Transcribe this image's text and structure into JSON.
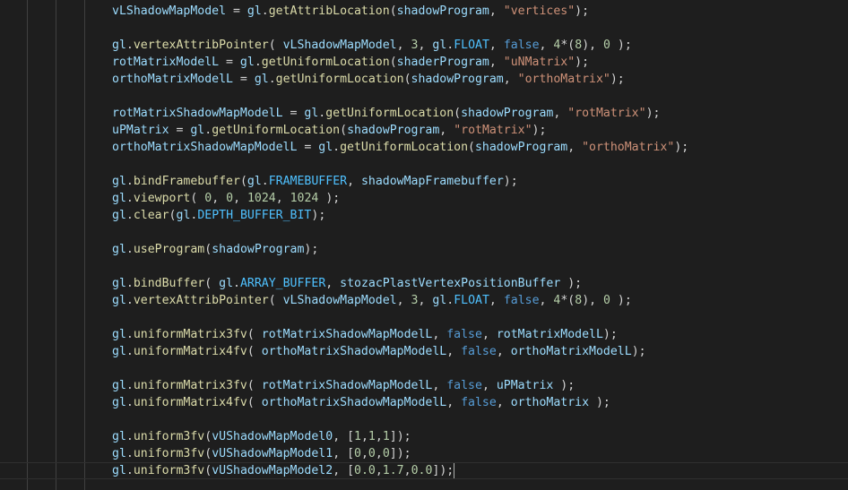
{
  "editor": {
    "lines": [
      [
        [
          "var",
          "vLShadowMapModel"
        ],
        [
          "p",
          " = "
        ],
        [
          "var",
          "gl"
        ],
        [
          "p",
          "."
        ],
        [
          "fn",
          "getAttribLocation"
        ],
        [
          "p",
          "("
        ],
        [
          "var",
          "shadowProgram"
        ],
        [
          "p",
          ", "
        ],
        [
          "str",
          "\"vertices\""
        ],
        [
          "p",
          ");"
        ]
      ],
      [],
      [
        [
          "var",
          "gl"
        ],
        [
          "p",
          "."
        ],
        [
          "fn",
          "vertexAttribPointer"
        ],
        [
          "p",
          "( "
        ],
        [
          "var",
          "vLShadowMapModel"
        ],
        [
          "p",
          ", "
        ],
        [
          "num",
          "3"
        ],
        [
          "p",
          ", "
        ],
        [
          "var",
          "gl"
        ],
        [
          "p",
          "."
        ],
        [
          "const",
          "FLOAT"
        ],
        [
          "p",
          ", "
        ],
        [
          "kw",
          "false"
        ],
        [
          "p",
          ", "
        ],
        [
          "num",
          "4"
        ],
        [
          "p",
          "*("
        ],
        [
          "num",
          "8"
        ],
        [
          "p",
          "), "
        ],
        [
          "num",
          "0"
        ],
        [
          "p",
          " );"
        ]
      ],
      [
        [
          "var",
          "rotMatrixModelL"
        ],
        [
          "p",
          " = "
        ],
        [
          "var",
          "gl"
        ],
        [
          "p",
          "."
        ],
        [
          "fn",
          "getUniformLocation"
        ],
        [
          "p",
          "("
        ],
        [
          "var",
          "shaderProgram"
        ],
        [
          "p",
          ", "
        ],
        [
          "str",
          "\"uNMatrix\""
        ],
        [
          "p",
          ");"
        ]
      ],
      [
        [
          "var",
          "orthoMatrixModelL"
        ],
        [
          "p",
          " = "
        ],
        [
          "var",
          "gl"
        ],
        [
          "p",
          "."
        ],
        [
          "fn",
          "getUniformLocation"
        ],
        [
          "p",
          "("
        ],
        [
          "var",
          "shadowProgram"
        ],
        [
          "p",
          ", "
        ],
        [
          "str",
          "\"orthoMatrix\""
        ],
        [
          "p",
          ");"
        ]
      ],
      [],
      [
        [
          "var",
          "rotMatrixShadowMapModelL"
        ],
        [
          "p",
          " = "
        ],
        [
          "var",
          "gl"
        ],
        [
          "p",
          "."
        ],
        [
          "fn",
          "getUniformLocation"
        ],
        [
          "p",
          "("
        ],
        [
          "var",
          "shadowProgram"
        ],
        [
          "p",
          ", "
        ],
        [
          "str",
          "\"rotMatrix\""
        ],
        [
          "p",
          ");"
        ]
      ],
      [
        [
          "var",
          "uPMatrix"
        ],
        [
          "p",
          " = "
        ],
        [
          "var",
          "gl"
        ],
        [
          "p",
          "."
        ],
        [
          "fn",
          "getUniformLocation"
        ],
        [
          "p",
          "("
        ],
        [
          "var",
          "shadowProgram"
        ],
        [
          "p",
          ", "
        ],
        [
          "str",
          "\"rotMatrix\""
        ],
        [
          "p",
          ");"
        ]
      ],
      [
        [
          "var",
          "orthoMatrixShadowMapModelL"
        ],
        [
          "p",
          " = "
        ],
        [
          "var",
          "gl"
        ],
        [
          "p",
          "."
        ],
        [
          "fn",
          "getUniformLocation"
        ],
        [
          "p",
          "("
        ],
        [
          "var",
          "shadowProgram"
        ],
        [
          "p",
          ", "
        ],
        [
          "str",
          "\"orthoMatrix\""
        ],
        [
          "p",
          ");"
        ]
      ],
      [],
      [
        [
          "var",
          "gl"
        ],
        [
          "p",
          "."
        ],
        [
          "fn",
          "bindFramebuffer"
        ],
        [
          "p",
          "("
        ],
        [
          "var",
          "gl"
        ],
        [
          "p",
          "."
        ],
        [
          "const",
          "FRAMEBUFFER"
        ],
        [
          "p",
          ", "
        ],
        [
          "var",
          "shadowMapFramebuffer"
        ],
        [
          "p",
          ");"
        ]
      ],
      [
        [
          "var",
          "gl"
        ],
        [
          "p",
          "."
        ],
        [
          "fn",
          "viewport"
        ],
        [
          "p",
          "( "
        ],
        [
          "num",
          "0"
        ],
        [
          "p",
          ", "
        ],
        [
          "num",
          "0"
        ],
        [
          "p",
          ", "
        ],
        [
          "num",
          "1024"
        ],
        [
          "p",
          ", "
        ],
        [
          "num",
          "1024"
        ],
        [
          "p",
          " );"
        ]
      ],
      [
        [
          "var",
          "gl"
        ],
        [
          "p",
          "."
        ],
        [
          "fn",
          "clear"
        ],
        [
          "p",
          "("
        ],
        [
          "var",
          "gl"
        ],
        [
          "p",
          "."
        ],
        [
          "const",
          "DEPTH_BUFFER_BIT"
        ],
        [
          "p",
          ");"
        ]
      ],
      [],
      [
        [
          "var",
          "gl"
        ],
        [
          "p",
          "."
        ],
        [
          "fn",
          "useProgram"
        ],
        [
          "p",
          "("
        ],
        [
          "var",
          "shadowProgram"
        ],
        [
          "p",
          ");"
        ]
      ],
      [],
      [
        [
          "var",
          "gl"
        ],
        [
          "p",
          "."
        ],
        [
          "fn",
          "bindBuffer"
        ],
        [
          "p",
          "( "
        ],
        [
          "var",
          "gl"
        ],
        [
          "p",
          "."
        ],
        [
          "const",
          "ARRAY_BUFFER"
        ],
        [
          "p",
          ", "
        ],
        [
          "var",
          "stozacPlastVertexPositionBuffer"
        ],
        [
          "p",
          " );"
        ]
      ],
      [
        [
          "var",
          "gl"
        ],
        [
          "p",
          "."
        ],
        [
          "fn",
          "vertexAttribPointer"
        ],
        [
          "p",
          "( "
        ],
        [
          "var",
          "vLShadowMapModel"
        ],
        [
          "p",
          ", "
        ],
        [
          "num",
          "3"
        ],
        [
          "p",
          ", "
        ],
        [
          "var",
          "gl"
        ],
        [
          "p",
          "."
        ],
        [
          "const",
          "FLOAT"
        ],
        [
          "p",
          ", "
        ],
        [
          "kw",
          "false"
        ],
        [
          "p",
          ", "
        ],
        [
          "num",
          "4"
        ],
        [
          "p",
          "*("
        ],
        [
          "num",
          "8"
        ],
        [
          "p",
          "), "
        ],
        [
          "num",
          "0"
        ],
        [
          "p",
          " );"
        ]
      ],
      [],
      [
        [
          "var",
          "gl"
        ],
        [
          "p",
          "."
        ],
        [
          "fn",
          "uniformMatrix3fv"
        ],
        [
          "p",
          "( "
        ],
        [
          "var",
          "rotMatrixShadowMapModelL"
        ],
        [
          "p",
          ", "
        ],
        [
          "kw",
          "false"
        ],
        [
          "p",
          ", "
        ],
        [
          "var",
          "rotMatrixModelL"
        ],
        [
          "p",
          ");"
        ]
      ],
      [
        [
          "var",
          "gl"
        ],
        [
          "p",
          "."
        ],
        [
          "fn",
          "uniformMatrix4fv"
        ],
        [
          "p",
          "( "
        ],
        [
          "var",
          "orthoMatrixShadowMapModelL"
        ],
        [
          "p",
          ", "
        ],
        [
          "kw",
          "false"
        ],
        [
          "p",
          ", "
        ],
        [
          "var",
          "orthoMatrixModelL"
        ],
        [
          "p",
          ");"
        ]
      ],
      [],
      [
        [
          "var",
          "gl"
        ],
        [
          "p",
          "."
        ],
        [
          "fn",
          "uniformMatrix3fv"
        ],
        [
          "p",
          "( "
        ],
        [
          "var",
          "rotMatrixShadowMapModelL"
        ],
        [
          "p",
          ", "
        ],
        [
          "kw",
          "false"
        ],
        [
          "p",
          ", "
        ],
        [
          "var",
          "uPMatrix"
        ],
        [
          "p",
          " );"
        ]
      ],
      [
        [
          "var",
          "gl"
        ],
        [
          "p",
          "."
        ],
        [
          "fn",
          "uniformMatrix4fv"
        ],
        [
          "p",
          "( "
        ],
        [
          "var",
          "orthoMatrixShadowMapModelL"
        ],
        [
          "p",
          ", "
        ],
        [
          "kw",
          "false"
        ],
        [
          "p",
          ", "
        ],
        [
          "var",
          "orthoMatrix"
        ],
        [
          "p",
          " );"
        ]
      ],
      [],
      [
        [
          "var",
          "gl"
        ],
        [
          "p",
          "."
        ],
        [
          "fn",
          "uniform3fv"
        ],
        [
          "p",
          "("
        ],
        [
          "var",
          "vUShadowMapModel0"
        ],
        [
          "p",
          ", ["
        ],
        [
          "num",
          "1"
        ],
        [
          "p",
          ","
        ],
        [
          "num",
          "1"
        ],
        [
          "p",
          ","
        ],
        [
          "num",
          "1"
        ],
        [
          "p",
          "]);"
        ]
      ],
      [
        [
          "var",
          "gl"
        ],
        [
          "p",
          "."
        ],
        [
          "fn",
          "uniform3fv"
        ],
        [
          "p",
          "("
        ],
        [
          "var",
          "vUShadowMapModel1"
        ],
        [
          "p",
          ", ["
        ],
        [
          "num",
          "0"
        ],
        [
          "p",
          ","
        ],
        [
          "num",
          "0"
        ],
        [
          "p",
          ","
        ],
        [
          "num",
          "0"
        ],
        [
          "p",
          "]);"
        ]
      ],
      [
        [
          "var",
          "gl"
        ],
        [
          "p",
          "."
        ],
        [
          "fn",
          "uniform3fv"
        ],
        [
          "p",
          "("
        ],
        [
          "var",
          "vUShadowMapModel2"
        ],
        [
          "p",
          ", ["
        ],
        [
          "num",
          "0.0"
        ],
        [
          "p",
          ","
        ],
        [
          "num",
          "1.7"
        ],
        [
          "p",
          ","
        ],
        [
          "num",
          "0.0"
        ],
        [
          "p",
          "]);"
        ]
      ]
    ],
    "current_line": 27,
    "colors": {
      "background": "#1e1e1e",
      "variable": "#9cdcfe",
      "function": "#dcdcaa",
      "string": "#ce9178",
      "number": "#b5cea8",
      "keyword": "#569cd6",
      "constant": "#4fc1ff",
      "punctuation": "#d4d4d4"
    }
  }
}
